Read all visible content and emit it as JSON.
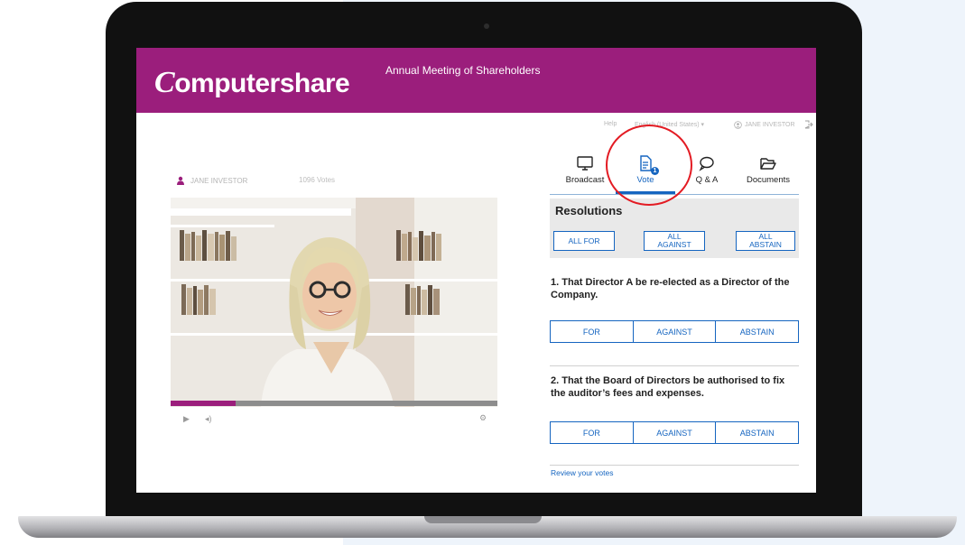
{
  "brand": {
    "logo_first": "C",
    "logo_rest": "omputershare",
    "banner_color": "#9b1e7c"
  },
  "meeting_title": "Annual Meeting of Shareholders",
  "topbar": {
    "help": "Help",
    "language": "English (United States)",
    "user": "JANE INVESTOR"
  },
  "viewer": {
    "name": "JANE INVESTOR",
    "votes": "1096 Votes"
  },
  "player": {
    "play_icon": "play-icon",
    "volume_icon": "volume-icon",
    "settings_icon": "gear-icon",
    "progress": 0.2
  },
  "tabs": [
    {
      "label": "Broadcast",
      "icon": "monitor-icon"
    },
    {
      "label": "Vote",
      "icon": "document-icon",
      "badge": "1",
      "active": true
    },
    {
      "label": "Q & A",
      "icon": "chat-bubble-icon"
    },
    {
      "label": "Documents",
      "icon": "folder-icon"
    }
  ],
  "resolutions": {
    "title": "Resolutions",
    "bulk": {
      "all_for": "ALL FOR",
      "all_against_1": "ALL",
      "all_against_2": "AGAINST",
      "all_abstain_1": "ALL",
      "all_abstain_2": "ABSTAIN"
    },
    "items": [
      {
        "text": "1. That Director A be re-elected as a Director of the Company.",
        "for": "FOR",
        "against": "AGAINST",
        "abstain": "ABSTAIN"
      },
      {
        "text": "2. That the Board of Directors be authorised to fix the auditor’s fees and expenses.",
        "for": "FOR",
        "against": "AGAINST",
        "abstain": "ABSTAIN"
      }
    ],
    "review_link": "Review your votes"
  },
  "colors": {
    "accent": "#1565c0",
    "highlight_circle": "#e31b23"
  }
}
